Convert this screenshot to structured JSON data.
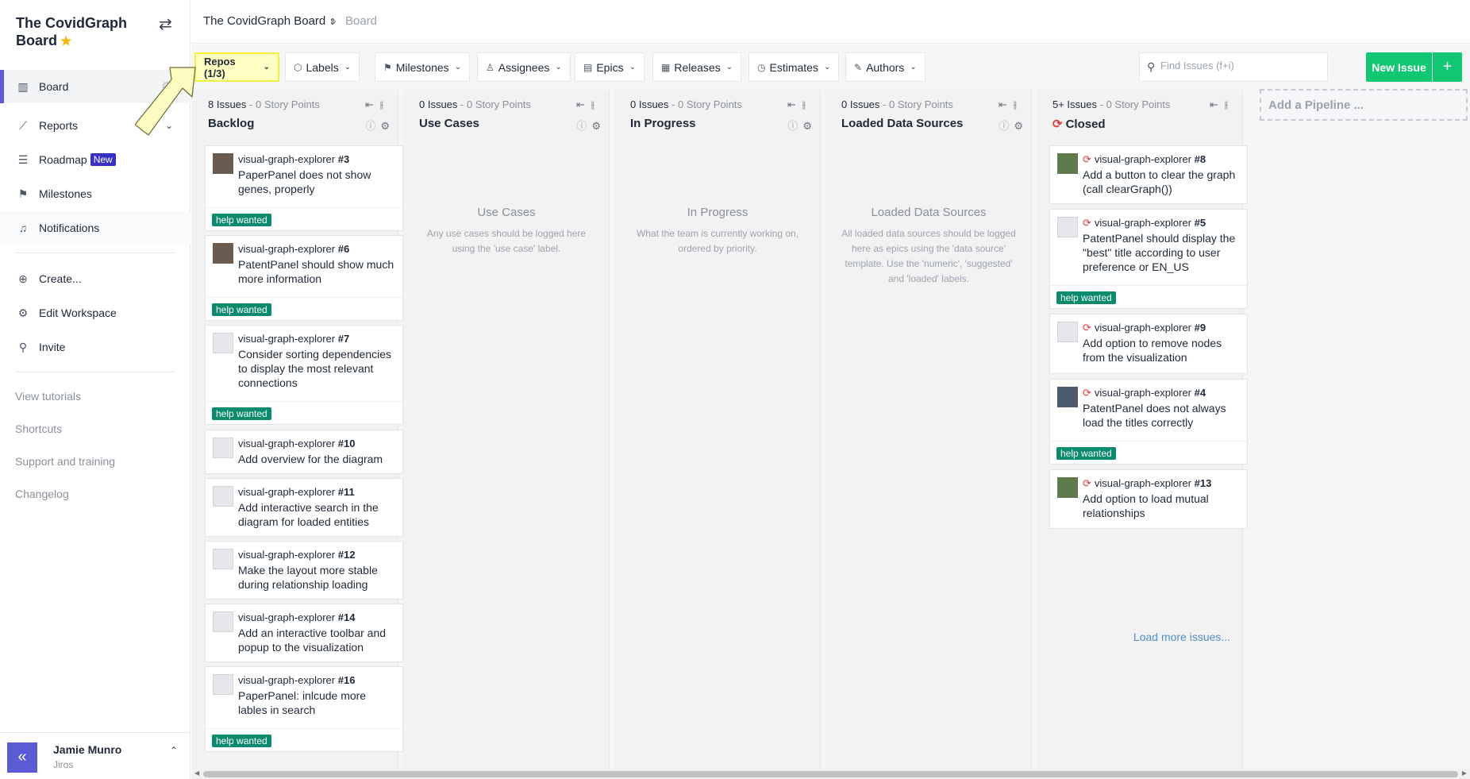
{
  "workspace": {
    "title": "The CovidGraph Board",
    "star": "★"
  },
  "sidebar": {
    "items": [
      {
        "label": "Board",
        "icon": "board-icon"
      },
      {
        "label": "Reports",
        "icon": "reports-icon"
      },
      {
        "label": "Roadmap",
        "icon": "roadmap-icon",
        "badge": "New"
      },
      {
        "label": "Milestones",
        "icon": "milestones-icon"
      },
      {
        "label": "Notifications",
        "icon": "bell-icon"
      },
      {
        "label": "Create...",
        "icon": "plus-circle-icon"
      },
      {
        "label": "Edit Workspace",
        "icon": "gear-icon"
      },
      {
        "label": "Invite",
        "icon": "add-person-icon"
      }
    ],
    "links": [
      "View tutorials",
      "Shortcuts",
      "Support and training",
      "Changelog"
    ],
    "collapse": "«",
    "user": {
      "name": "Jamie Munro",
      "org": "Jiros"
    }
  },
  "breadcrumb": {
    "board": "The CovidGraph Board",
    "current": "Board"
  },
  "filters": [
    "Repos (1/3)",
    "Labels",
    "Milestones",
    "Assignees",
    "Epics",
    "Releases",
    "Estimates",
    "Authors"
  ],
  "search": {
    "placeholder": "Find Issues (f+i)"
  },
  "new_issue": "New Issue",
  "pipelines": [
    {
      "count": "8 Issues",
      "points": "- 0 Story Points",
      "name": "Backlog"
    },
    {
      "count": "0 Issues",
      "points": "- 0 Story Points",
      "name": "Use Cases",
      "empty_title": "Use Cases",
      "empty_desc": "Any use cases should be logged here using the 'use case' label."
    },
    {
      "count": "0 Issues",
      "points": "- 0 Story Points",
      "name": "In Progress",
      "empty_title": "In Progress",
      "empty_desc": "What the team is currently working on, ordered by priority."
    },
    {
      "count": "0 Issues",
      "points": "- 0 Story Points",
      "name": "Loaded Data Sources",
      "empty_title": "Loaded Data Sources",
      "empty_desc": "All loaded data sources should be logged here as epics using the 'data source' template. Use the 'numeric', 'suggested' and 'loaded' labels."
    },
    {
      "count": "5+ Issues",
      "points": "- 0 Story Points",
      "name": "Closed"
    }
  ],
  "backlog_cards": [
    {
      "repo": "visual-graph-explorer",
      "num": "#3",
      "title": "PaperPanel does not show genes, properly",
      "label": "help wanted"
    },
    {
      "repo": "visual-graph-explorer",
      "num": "#6",
      "title": "PatentPanel should show much more information",
      "label": "help wanted"
    },
    {
      "repo": "visual-graph-explorer",
      "num": "#7",
      "title": "Consider sorting dependencies to display the most relevant connections",
      "label": "help wanted"
    },
    {
      "repo": "visual-graph-explorer",
      "num": "#10",
      "title": "Add overview for the diagram"
    },
    {
      "repo": "visual-graph-explorer",
      "num": "#11",
      "title": "Add interactive search in the diagram for loaded entities"
    },
    {
      "repo": "visual-graph-explorer",
      "num": "#12",
      "title": "Make the layout more stable during relationship loading"
    },
    {
      "repo": "visual-graph-explorer",
      "num": "#14",
      "title": "Add an interactive toolbar and popup to the visualization"
    },
    {
      "repo": "visual-graph-explorer",
      "num": "#16",
      "title": "PaperPanel: inlcude more lables in search",
      "label": "help wanted"
    }
  ],
  "closed_cards": [
    {
      "repo": "visual-graph-explorer",
      "num": "#8",
      "title": "Add a button to clear the graph (call clearGraph())"
    },
    {
      "repo": "visual-graph-explorer",
      "num": "#5",
      "title": "PatentPanel should display the \"best\" title according to user preference or EN_US",
      "label": "help wanted"
    },
    {
      "repo": "visual-graph-explorer",
      "num": "#9",
      "title": "Add option to remove nodes from the visualization"
    },
    {
      "repo": "visual-graph-explorer",
      "num": "#4",
      "title": "PatentPanel does not always load the titles correctly",
      "label": "help wanted"
    },
    {
      "repo": "visual-graph-explorer",
      "num": "#13",
      "title": "Add option to load mutual relationships"
    }
  ],
  "load_more": "Load more issues...",
  "add_pipeline": "Add a Pipeline ...",
  "colors": {
    "accent": "#5b5bd6",
    "new_issue": "#10c872",
    "label": "#0a8a6e",
    "closed": "#e03d3d",
    "highlight": "#fffec2"
  }
}
